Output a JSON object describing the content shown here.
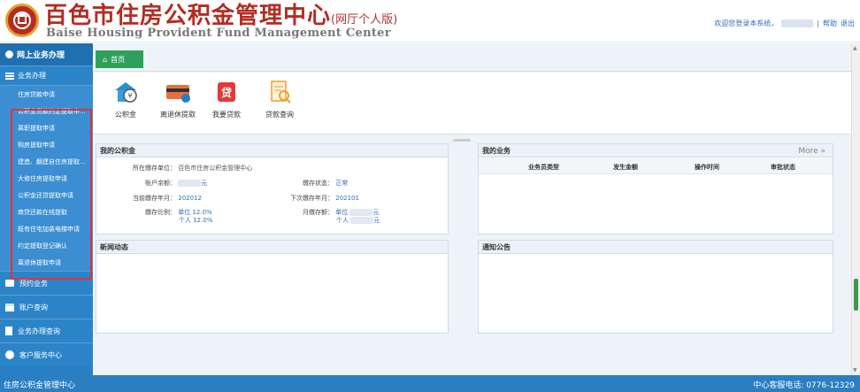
{
  "header": {
    "title": "百色市住房公积金管理中心",
    "title_suffix": "(网厅个人版)",
    "title_en": "Baise Housing Provident Fund Management Center",
    "welcome": "欢迎您登录本系统，",
    "help": "帮助",
    "logout": "退出"
  },
  "sidebar": {
    "head": "网上业务办理",
    "section": "业务办理",
    "sub_items": [
      "住房贷款申请",
      "公积金贷款约定提取申...",
      "离职提取申请",
      "购房提取申请",
      "建造、翻建自住房提取...",
      "大修住房提取申请",
      "公积金还贷提取申请",
      "商贷还款在线提取",
      "既有住宅加装电梯申请",
      "约定提取登记确认",
      "离退休提取申请"
    ],
    "groups": [
      "预约业务",
      "账户查询",
      "业务办理查询",
      "客户服务中心"
    ]
  },
  "tab": {
    "label": "首页"
  },
  "quick": [
    "公积金",
    "离退休提取",
    "我要贷款",
    "贷款查询"
  ],
  "fund": {
    "title": "我的公积金",
    "unit_label": "所在缴存单位：",
    "unit_value": "百色市住房公积金管理中心",
    "balance_label": "账户余额：",
    "balance_unit": "元",
    "status_label": "缴存状态：",
    "status_value": "正常",
    "current_label": "当前缴存年月：",
    "current_value": "202012",
    "next_label": "下次缴存年月：",
    "next_value": "202101",
    "ratio_label": "缴存比例：",
    "ratio_unit": "单位 12.0%",
    "ratio_person": "个人 12.0%",
    "monthly_label": "月缴存额：",
    "monthly_unit_prefix": "单位",
    "monthly_person_prefix": "个人",
    "yuan": "元"
  },
  "business": {
    "title": "我的业务",
    "more": "More",
    "columns": [
      "业务员类型",
      "发生金额",
      "操作时间",
      "审批状态"
    ]
  },
  "news": {
    "title": "新闻动态"
  },
  "notice": {
    "title": "通知公告"
  },
  "footer": {
    "left": "住房公积金管理中心",
    "right": "中心客服电话: 0776-12329"
  }
}
